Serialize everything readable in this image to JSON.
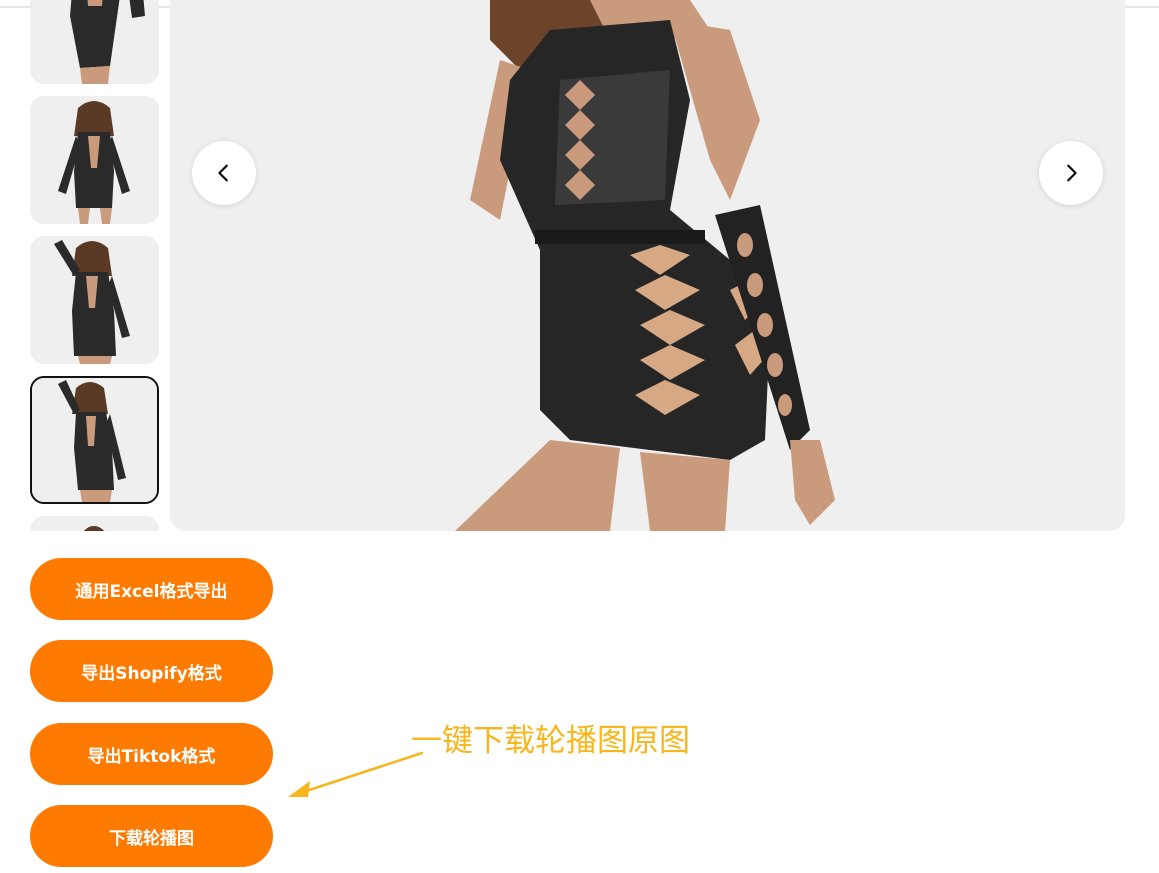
{
  "gallery": {
    "thumbnails": [
      {
        "selected": false
      },
      {
        "selected": false
      },
      {
        "selected": false
      },
      {
        "selected": true
      },
      {
        "selected": false
      }
    ],
    "prev_icon": "chevron-left-icon",
    "next_icon": "chevron-right-icon"
  },
  "actions": {
    "excel_export_label": "通用Excel格式导出",
    "shopify_export_label": "导出Shopify格式",
    "tiktok_export_label": "导出Tiktok格式",
    "download_carousel_label": "下载轮播图"
  },
  "annotation": {
    "text": "一键下载轮播图原图",
    "color": "#f6b61c"
  },
  "colors": {
    "accent": "#ff7a00",
    "image_bg": "#efefef"
  }
}
